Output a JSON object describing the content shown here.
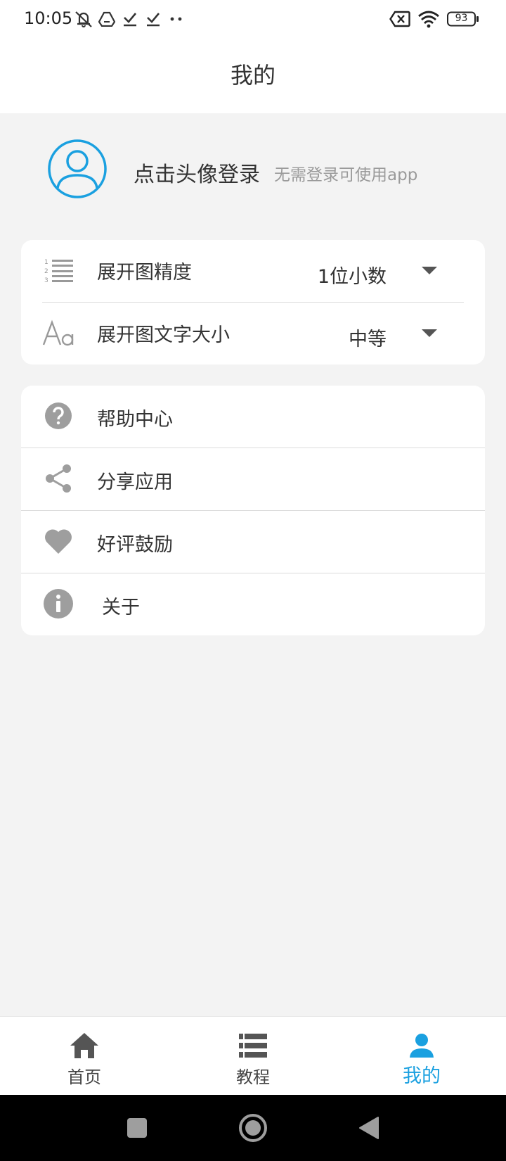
{
  "status_bar": {
    "time": "10:05",
    "battery": "93",
    "left_icons": [
      "notifications-muted-icon",
      "drive-icon",
      "download-done-icon",
      "download-done-icon",
      "more-dots-icon"
    ],
    "right_icons": [
      "sim-error-icon",
      "wifi-icon",
      "battery-icon"
    ]
  },
  "app_bar": {
    "title": "我的"
  },
  "profile": {
    "login_text": "点击头像登录",
    "login_hint": "无需登录可使用app",
    "avatar_color": "#1aa0e0"
  },
  "settings": [
    {
      "icon": "numbered-list-icon",
      "label": "展开图精度",
      "value": "1位小数"
    },
    {
      "icon": "font-size-icon",
      "label": "展开图文字大小",
      "value": "中等"
    }
  ],
  "menu": [
    {
      "icon": "help-icon",
      "label": "帮助中心"
    },
    {
      "icon": "share-icon",
      "label": "分享应用"
    },
    {
      "icon": "heart-icon",
      "label": "好评鼓励"
    },
    {
      "icon": "info-icon",
      "label": "关于"
    }
  ],
  "tab_bar": {
    "tabs": [
      {
        "icon": "home-icon",
        "label": "首页",
        "active": false
      },
      {
        "icon": "list-icon",
        "label": "教程",
        "active": false
      },
      {
        "icon": "person-icon",
        "label": "我的",
        "active": true
      }
    ],
    "active_color": "#1aa0e0"
  },
  "nav_bar": {
    "buttons": [
      "recents-button",
      "home-button",
      "back-button"
    ]
  }
}
